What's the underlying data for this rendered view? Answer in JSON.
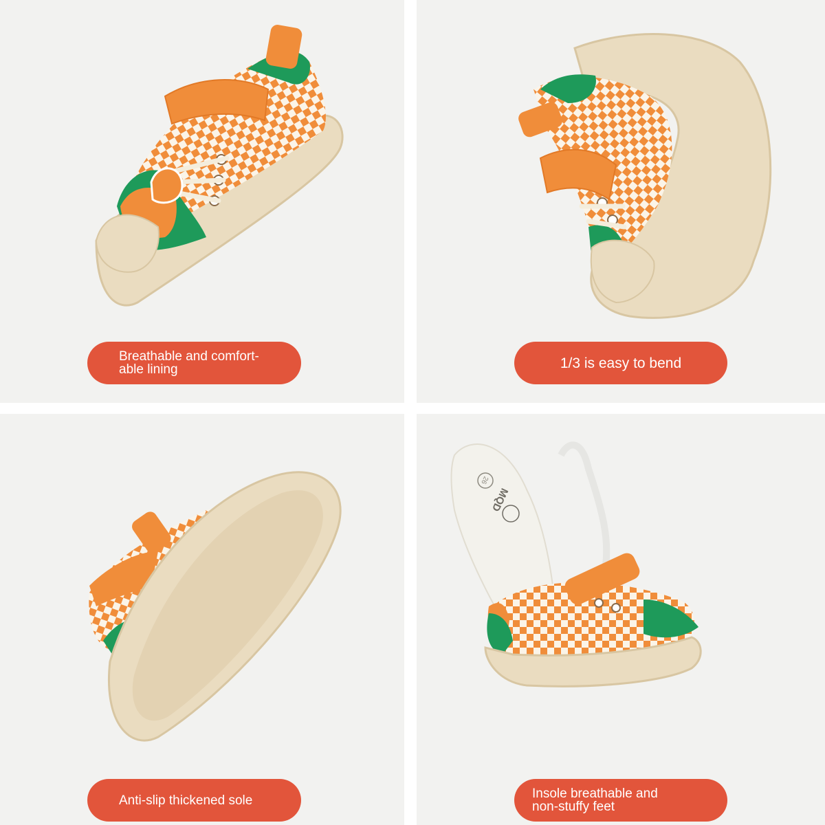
{
  "panels": [
    {
      "caption": "Breathable and comfort-\nable lining"
    },
    {
      "caption": "1/3 is easy to bend"
    },
    {
      "caption": "Anti-slip thickened sole"
    },
    {
      "caption": "Insole breathable and\nnon-stuffy feet"
    }
  ],
  "insole": {
    "brand": "MQD",
    "size": "26"
  },
  "colors": {
    "orange": "#f08d3a",
    "green": "#1e9a5a",
    "sole": "#eadcc0",
    "pill": "#e2553b",
    "background": "#f2f2f0"
  }
}
